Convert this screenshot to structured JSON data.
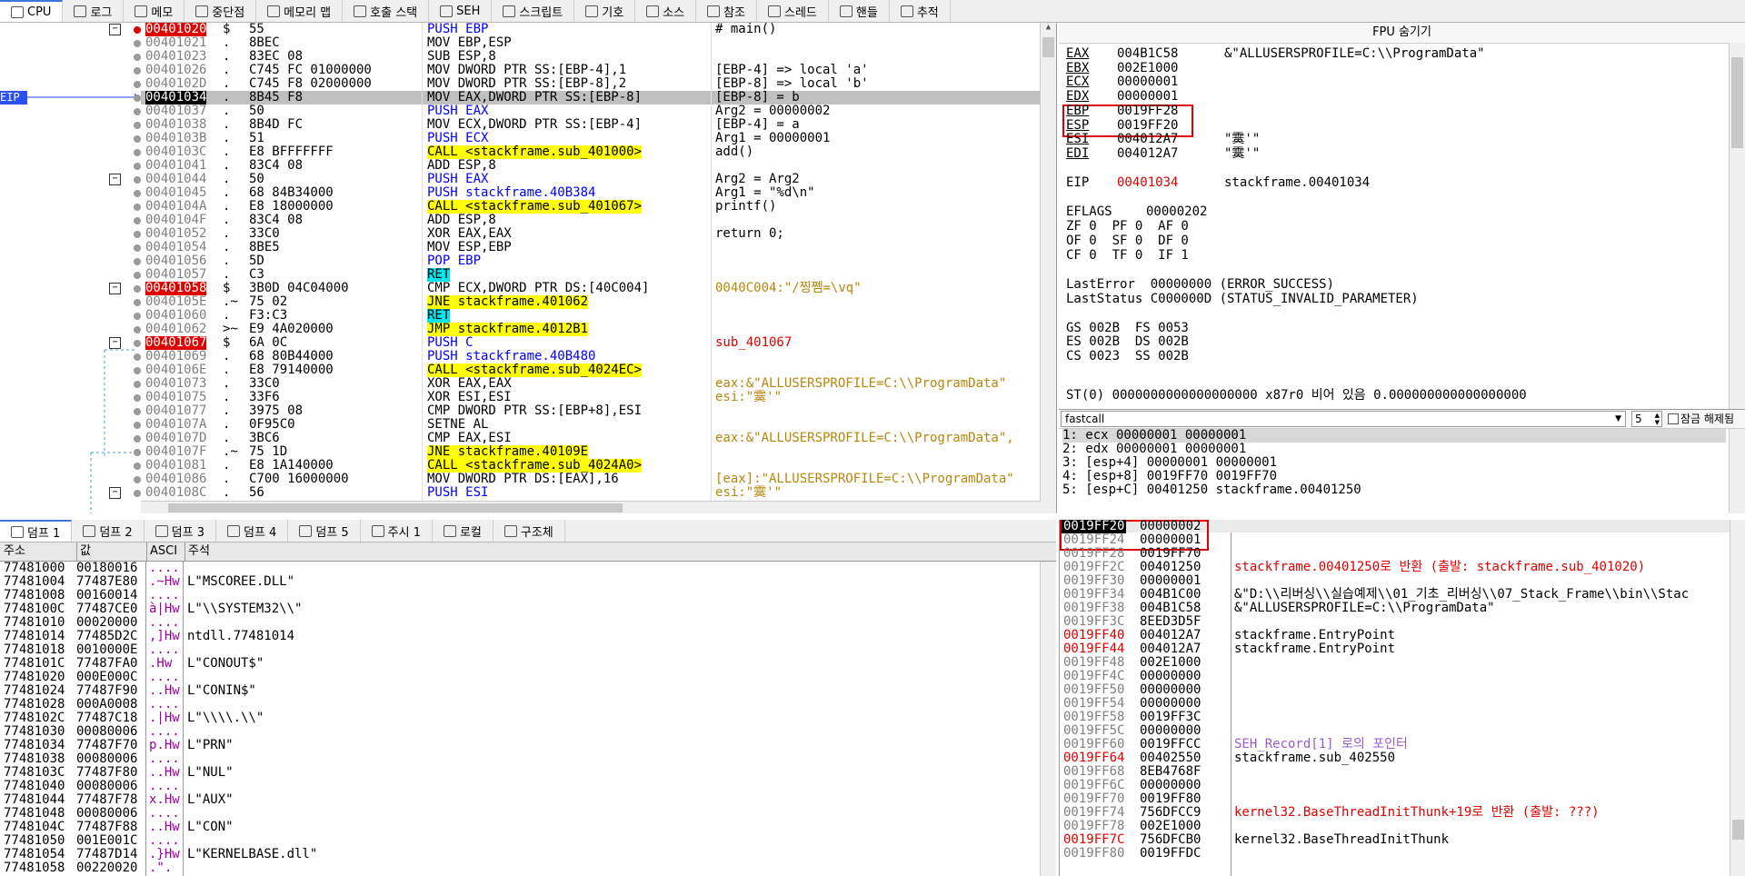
{
  "tabs": [
    {
      "label": "CPU",
      "icon": "cpu-icon"
    },
    {
      "label": "로그",
      "icon": "log-icon"
    },
    {
      "label": "메모",
      "icon": "note-icon"
    },
    {
      "label": "중단점",
      "icon": "breakpoint-icon"
    },
    {
      "label": "메모리 맵",
      "icon": "memory-map-icon"
    },
    {
      "label": "호출 스택",
      "icon": "call-stack-icon"
    },
    {
      "label": "SEH",
      "icon": "seh-icon"
    },
    {
      "label": "스크립트",
      "icon": "script-icon"
    },
    {
      "label": "기호",
      "icon": "symbol-icon"
    },
    {
      "label": "소스",
      "icon": "source-icon"
    },
    {
      "label": "참조",
      "icon": "reference-icon"
    },
    {
      "label": "스레드",
      "icon": "thread-icon"
    },
    {
      "label": "핸들",
      "icon": "handle-icon"
    },
    {
      "label": "추적",
      "icon": "trace-icon"
    }
  ],
  "eip_label": "EIP",
  "disasm": [
    {
      "addr": "00401020",
      "bytes": "55",
      "instr": "PUSH EBP",
      "comment": "# main()",
      "marker": "$",
      "addr_style": "red",
      "bp": true
    },
    {
      "addr": "00401021",
      "bytes": "8BEC",
      "instr": "MOV EBP,ESP",
      "comment": "",
      "marker": "."
    },
    {
      "addr": "00401023",
      "bytes": "83EC 08",
      "instr": "SUB ESP,8",
      "comment": "",
      "marker": "."
    },
    {
      "addr": "00401026",
      "bytes": "C745 FC 01000000",
      "instr": "MOV DWORD PTR SS:[EBP-4],1",
      "comment": "[EBP-4] => local 'a'",
      "marker": "."
    },
    {
      "addr": "0040102D",
      "bytes": "C745 F8 02000000",
      "instr": "MOV DWORD PTR SS:[EBP-8],2",
      "comment": "[EBP-8] => local 'b'",
      "marker": "."
    },
    {
      "addr": "00401034",
      "bytes": "8B45 F8",
      "instr": "MOV EAX,DWORD PTR SS:[EBP-8]",
      "comment": "[EBP-8] = b",
      "marker": ".",
      "addr_style": "black",
      "selected": true
    },
    {
      "addr": "00401037",
      "bytes": "50",
      "instr": "PUSH EAX",
      "comment": "Arg2 = 00000002",
      "marker": "."
    },
    {
      "addr": "00401038",
      "bytes": "8B4D FC",
      "instr": "MOV ECX,DWORD PTR SS:[EBP-4]",
      "comment": "[EBP-4] = a",
      "marker": "."
    },
    {
      "addr": "0040103B",
      "bytes": "51",
      "instr": "PUSH ECX",
      "comment": "Arg1 = 00000001",
      "marker": "."
    },
    {
      "addr": "0040103C",
      "bytes": "E8 BFFFFFFF",
      "instr": "CALL <stackframe.sub_401000>",
      "comment": "add()",
      "marker": ".",
      "call": true
    },
    {
      "addr": "00401041",
      "bytes": "83C4 08",
      "instr": "ADD ESP,8",
      "comment": "",
      "marker": "."
    },
    {
      "addr": "00401044",
      "bytes": "50",
      "instr": "PUSH EAX",
      "comment": "Arg2 = Arg2",
      "marker": "."
    },
    {
      "addr": "00401045",
      "bytes": "68 84B34000",
      "instr": "PUSH stackframe.40B384",
      "comment": "Arg1 = \"%d\\n\"",
      "marker": "."
    },
    {
      "addr": "0040104A",
      "bytes": "E8 18000000",
      "instr": "CALL <stackframe.sub_401067>",
      "comment": "printf()",
      "marker": ".",
      "call": true
    },
    {
      "addr": "0040104F",
      "bytes": "83C4 08",
      "instr": "ADD ESP,8",
      "comment": "",
      "marker": "."
    },
    {
      "addr": "00401052",
      "bytes": "33C0",
      "instr": "XOR EAX,EAX",
      "comment": "return 0;",
      "marker": "."
    },
    {
      "addr": "00401054",
      "bytes": "8BE5",
      "instr": "MOV ESP,EBP",
      "comment": "",
      "marker": "."
    },
    {
      "addr": "00401056",
      "bytes": "5D",
      "instr": "POP EBP",
      "comment": "",
      "marker": "."
    },
    {
      "addr": "00401057",
      "bytes": "C3",
      "instr": "RET",
      "comment": "",
      "marker": "."
    },
    {
      "addr": "00401058",
      "bytes": "3B0D 04C04000",
      "instr": "CMP ECX,DWORD PTR DS:[40C004]",
      "comment": "0040C004:\"/찡쩸=\\vq\"",
      "marker": "$",
      "addr_style": "red"
    },
    {
      "addr": "0040105E",
      "bytes": "75 02",
      "instr": "JNE stackframe.401062",
      "comment": "",
      "marker": ".~"
    },
    {
      "addr": "00401060",
      "bytes": "F3:C3",
      "instr": "RET",
      "comment": "",
      "marker": "."
    },
    {
      "addr": "00401062",
      "bytes": "E9 4A020000",
      "instr": "JMP stackframe.4012B1",
      "comment": "",
      "marker": ">~"
    },
    {
      "addr": "00401067",
      "bytes": "6A 0C",
      "instr": "PUSH C",
      "comment": "sub_401067",
      "marker": "$",
      "addr_style": "red"
    },
    {
      "addr": "00401069",
      "bytes": "68 80B44000",
      "instr": "PUSH stackframe.40B480",
      "comment": "",
      "marker": "."
    },
    {
      "addr": "0040106E",
      "bytes": "E8 79140000",
      "instr": "CALL <stackframe.sub_4024EC>",
      "comment": "",
      "marker": ".",
      "call": true
    },
    {
      "addr": "00401073",
      "bytes": "33C0",
      "instr": "XOR EAX,EAX",
      "comment": "eax:&\"ALLUSERSPROFILE=C:\\\\ProgramData\"",
      "marker": "."
    },
    {
      "addr": "00401075",
      "bytes": "33F6",
      "instr": "XOR ESI,ESI",
      "comment": "esi:\"霙'\"",
      "marker": "."
    },
    {
      "addr": "00401077",
      "bytes": "3975 08",
      "instr": "CMP DWORD PTR SS:[EBP+8],ESI",
      "comment": "",
      "marker": "."
    },
    {
      "addr": "0040107A",
      "bytes": "0F95C0",
      "instr": "SETNE AL",
      "comment": "",
      "marker": "."
    },
    {
      "addr": "0040107D",
      "bytes": "3BC6",
      "instr": "CMP EAX,ESI",
      "comment": "eax:&\"ALLUSERSPROFILE=C:\\\\ProgramData\",",
      "marker": "."
    },
    {
      "addr": "0040107F",
      "bytes": "75 1D",
      "instr": "JNE stackframe.40109E",
      "comment": "",
      "marker": ".~"
    },
    {
      "addr": "00401081",
      "bytes": "E8 1A140000",
      "instr": "CALL <stackframe.sub_4024A0>",
      "comment": "",
      "marker": ".",
      "call": true
    },
    {
      "addr": "00401086",
      "bytes": "C700 16000000",
      "instr": "MOV DWORD PTR DS:[EAX],16",
      "comment": "[eax]:\"ALLUSERSPROFILE=C:\\\\ProgramData\"",
      "marker": "."
    },
    {
      "addr": "0040108C",
      "bytes": "56",
      "instr": "PUSH ESI",
      "comment": "esi:\"霙'\"",
      "marker": "."
    }
  ],
  "fpu_header": "FPU 숨기기",
  "registers": [
    {
      "name": "EAX",
      "value": "004B1C58",
      "desc": "&\"ALLUSERSPROFILE=C:\\\\ProgramData\""
    },
    {
      "name": "EBX",
      "value": "002E1000",
      "desc": ""
    },
    {
      "name": "ECX",
      "value": "00000001",
      "desc": ""
    },
    {
      "name": "EDX",
      "value": "00000001",
      "desc": ""
    },
    {
      "name": "EBP",
      "value": "0019FF28",
      "desc": ""
    },
    {
      "name": "ESP",
      "value": "0019FF20",
      "desc": ""
    },
    {
      "name": "ESI",
      "value": "004012A7",
      "desc": "\"霙'\""
    },
    {
      "name": "EDI",
      "value": "004012A7",
      "desc": "\"霙'\""
    }
  ],
  "eip_reg": {
    "name": "EIP",
    "value": "00401034",
    "desc": "stackframe.00401034"
  },
  "eflags": {
    "name": "EFLAGS",
    "value": "00000202"
  },
  "flags_lines": [
    "ZF 0  PF 0  AF 0",
    "OF 0  SF 0  DF 0",
    "CF 0  TF 0  IF 1"
  ],
  "last_error": "LastError  00000000 (ERROR_SUCCESS)",
  "last_status": "LastStatus C000000D (STATUS_INVALID_PARAMETER)",
  "segments": [
    "GS 002B  FS 0053",
    "ES 002B  DS 002B",
    "CS 0023  SS 002B"
  ],
  "st0": "ST(0) 0000000000000000000 x87r0 비어 있음 0.000000000000000000",
  "callconv": {
    "selected": "fastcall",
    "count": "5",
    "unlock_label": "잠금 해제됨"
  },
  "args": [
    "1: ecx 00000001 00000001",
    "2: edx 00000001 00000001",
    "3: [esp+4] 00000001 00000001",
    "4: [esp+8] 0019FF70 0019FF70",
    "5: [esp+C] 00401250 stackframe.00401250"
  ],
  "dump_tabs": [
    {
      "label": "덤프 1",
      "icon": "dump-icon"
    },
    {
      "label": "덤프 2",
      "icon": "dump-icon"
    },
    {
      "label": "덤프 3",
      "icon": "dump-icon"
    },
    {
      "label": "덤프 4",
      "icon": "dump-icon"
    },
    {
      "label": "덤프 5",
      "icon": "dump-icon"
    },
    {
      "label": "주시 1",
      "icon": "watch-icon"
    },
    {
      "label": "로컬",
      "icon": "locals-icon"
    },
    {
      "label": "구조체",
      "icon": "struct-icon"
    }
  ],
  "dump_headers": {
    "addr": "주소",
    "value": "값",
    "ascii": "ASCI",
    "comment": "주석"
  },
  "dump": [
    {
      "addr": "77481000",
      "value": "00180016",
      "ascii": "....",
      "comment": ""
    },
    {
      "addr": "77481004",
      "value": "77487E80",
      "ascii": ".~Hw",
      "comment": "L\"MSCOREE.DLL\""
    },
    {
      "addr": "77481008",
      "value": "00160014",
      "ascii": "....",
      "comment": ""
    },
    {
      "addr": "7748100C",
      "value": "77487CE0",
      "ascii": "à|Hw",
      "comment": "L\"\\\\SYSTEM32\\\\\""
    },
    {
      "addr": "77481010",
      "value": "00020000",
      "ascii": "....",
      "comment": ""
    },
    {
      "addr": "77481014",
      "value": "77485D2C",
      "ascii": ",]Hw",
      "comment": "ntdll.77481014"
    },
    {
      "addr": "77481018",
      "value": "0010000E",
      "ascii": "....",
      "comment": ""
    },
    {
      "addr": "7748101C",
      "value": "77487FA0",
      "ascii": ".Hw",
      "comment": "L\"CONOUT$\""
    },
    {
      "addr": "77481020",
      "value": "000E000C",
      "ascii": "....",
      "comment": ""
    },
    {
      "addr": "77481024",
      "value": "77487F90",
      "ascii": "..Hw",
      "comment": "L\"CONIN$\""
    },
    {
      "addr": "77481028",
      "value": "000A0008",
      "ascii": "....",
      "comment": ""
    },
    {
      "addr": "7748102C",
      "value": "77487C18",
      "ascii": ".|Hw",
      "comment": "L\"\\\\\\\\.\\\\\""
    },
    {
      "addr": "77481030",
      "value": "00080006",
      "ascii": "....",
      "comment": ""
    },
    {
      "addr": "77481034",
      "value": "77487F70",
      "ascii": "p.Hw",
      "comment": "L\"PRN\""
    },
    {
      "addr": "77481038",
      "value": "00080006",
      "ascii": "....",
      "comment": ""
    },
    {
      "addr": "7748103C",
      "value": "77487F80",
      "ascii": "..Hw",
      "comment": "L\"NUL\""
    },
    {
      "addr": "77481040",
      "value": "00080006",
      "ascii": "....",
      "comment": ""
    },
    {
      "addr": "77481044",
      "value": "77487F78",
      "ascii": "x.Hw",
      "comment": "L\"AUX\""
    },
    {
      "addr": "77481048",
      "value": "00080006",
      "ascii": "....",
      "comment": ""
    },
    {
      "addr": "7748104C",
      "value": "77487F88",
      "ascii": "..Hw",
      "comment": "L\"CON\""
    },
    {
      "addr": "77481050",
      "value": "001E001C",
      "ascii": "....",
      "comment": ""
    },
    {
      "addr": "77481054",
      "value": "77487D14",
      "ascii": ".}Hw",
      "comment": "L\"KERNELBASE.dll\""
    },
    {
      "addr": "77481058",
      "value": "00220020",
      "ascii": ".\".",
      "comment": ""
    }
  ],
  "stack": [
    {
      "addr": "0019FF20",
      "value": "00000002",
      "comment": "",
      "style": "selected"
    },
    {
      "addr": "0019FF24",
      "value": "00000001",
      "comment": ""
    },
    {
      "addr": "0019FF28",
      "value": "0019FF70",
      "comment": ""
    },
    {
      "addr": "0019FF2C",
      "value": "00401250",
      "comment": "stackframe.00401250로 반환 (출발: stackframe.sub_401020)",
      "ctype": "red"
    },
    {
      "addr": "0019FF30",
      "value": "00000001",
      "comment": ""
    },
    {
      "addr": "0019FF34",
      "value": "004B1C00",
      "comment": "&\"D:\\\\리버싱\\\\실습예제\\\\01_기초_리버싱\\\\07_Stack_Frame\\\\bin\\\\Stac"
    },
    {
      "addr": "0019FF38",
      "value": "004B1C58",
      "comment": "&\"ALLUSERSPROFILE=C:\\\\ProgramData\""
    },
    {
      "addr": "0019FF3C",
      "value": "8EED3D5F",
      "comment": ""
    },
    {
      "addr": "0019FF40",
      "value": "004012A7",
      "comment": "stackframe.EntryPoint",
      "astyle": "red"
    },
    {
      "addr": "0019FF44",
      "value": "004012A7",
      "comment": "stackframe.EntryPoint",
      "astyle": "red"
    },
    {
      "addr": "0019FF48",
      "value": "002E1000",
      "comment": ""
    },
    {
      "addr": "0019FF4C",
      "value": "00000000",
      "comment": ""
    },
    {
      "addr": "0019FF50",
      "value": "00000000",
      "comment": ""
    },
    {
      "addr": "0019FF54",
      "value": "00000000",
      "comment": ""
    },
    {
      "addr": "0019FF58",
      "value": "0019FF3C",
      "comment": ""
    },
    {
      "addr": "0019FF5C",
      "value": "00000000",
      "comment": ""
    },
    {
      "addr": "0019FF60",
      "value": "0019FFCC",
      "comment": "SEH_Record[1] 로의 포인터",
      "ctype": "purple"
    },
    {
      "addr": "0019FF64",
      "value": "00402550",
      "comment": "stackframe.sub_402550",
      "astyle": "red"
    },
    {
      "addr": "0019FF68",
      "value": "8EB4768F",
      "comment": ""
    },
    {
      "addr": "0019FF6C",
      "value": "00000000",
      "comment": ""
    },
    {
      "addr": "0019FF70",
      "value": "0019FF80",
      "comment": ""
    },
    {
      "addr": "0019FF74",
      "value": "756DFCC9",
      "comment": "kernel32.BaseThreadInitThunk+19로 반환 (출발: ???)",
      "ctype": "red"
    },
    {
      "addr": "0019FF78",
      "value": "002E1000",
      "comment": ""
    },
    {
      "addr": "0019FF7C",
      "value": "756DFCB0",
      "comment": "kernel32.BaseThreadInitThunk",
      "astyle": "red"
    },
    {
      "addr": "0019FF80",
      "value": "0019FFDC",
      "comment": ""
    }
  ],
  "colors": {
    "accent_red": "#e00000",
    "call_yellow": "#ffff00",
    "push_blue": "#0000ff",
    "jump_cyan": "#00e5ee",
    "comment_orange": "#b8860b"
  }
}
